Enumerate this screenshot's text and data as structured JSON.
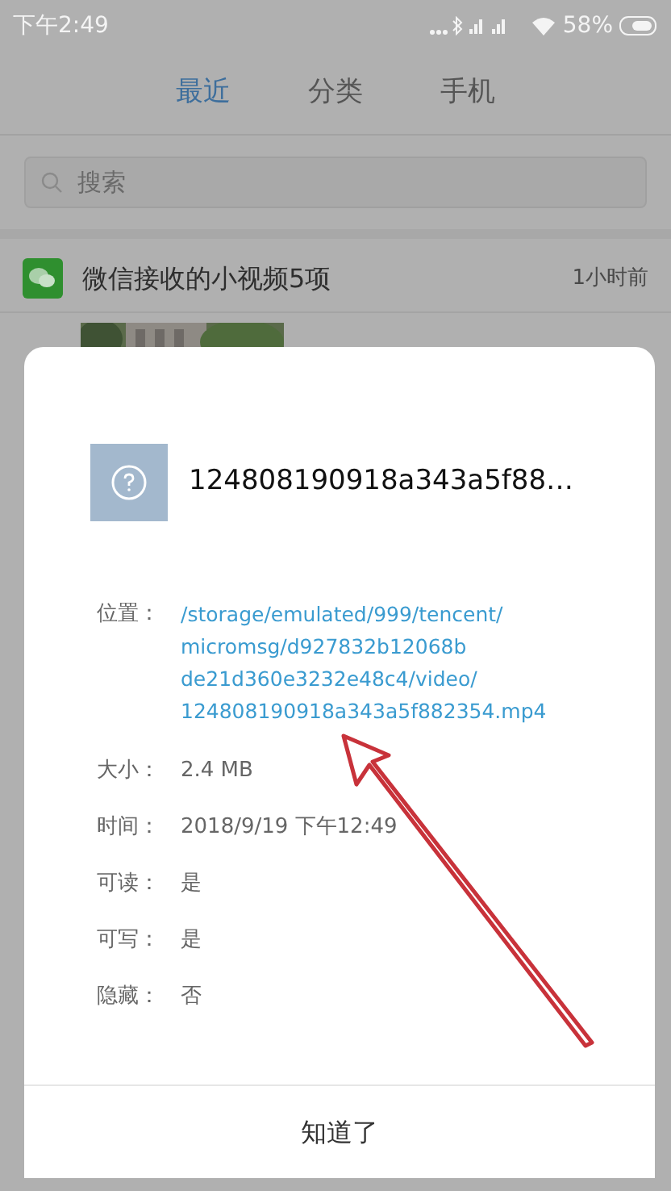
{
  "status_bar": {
    "time": "下午2:49",
    "battery": "58%"
  },
  "tabs": [
    {
      "label": "最近",
      "selected": true
    },
    {
      "label": "分类",
      "selected": false
    },
    {
      "label": "手机",
      "selected": false
    }
  ],
  "search": {
    "placeholder": "搜索"
  },
  "group": {
    "title": "微信接收的小视频5项",
    "time": "1小时前"
  },
  "dialog": {
    "title": "124808190918a343a5f88…",
    "path_label": "位置：",
    "path_lines": [
      "/storage/emulated/999/tencent/",
      "micromsg/d927832b12068b",
      "de21d360e3232e48c4/video/",
      "124808190918a343a5f882354.mp4"
    ],
    "rows": [
      {
        "label": "大小：",
        "value": "2.4 MB"
      },
      {
        "label": "时间：",
        "value": "2018/9/19 下午12:49"
      },
      {
        "label": "可读：",
        "value": "是"
      },
      {
        "label": "可写：",
        "value": "是"
      },
      {
        "label": "隐藏：",
        "value": "否"
      }
    ],
    "button": "知道了"
  }
}
